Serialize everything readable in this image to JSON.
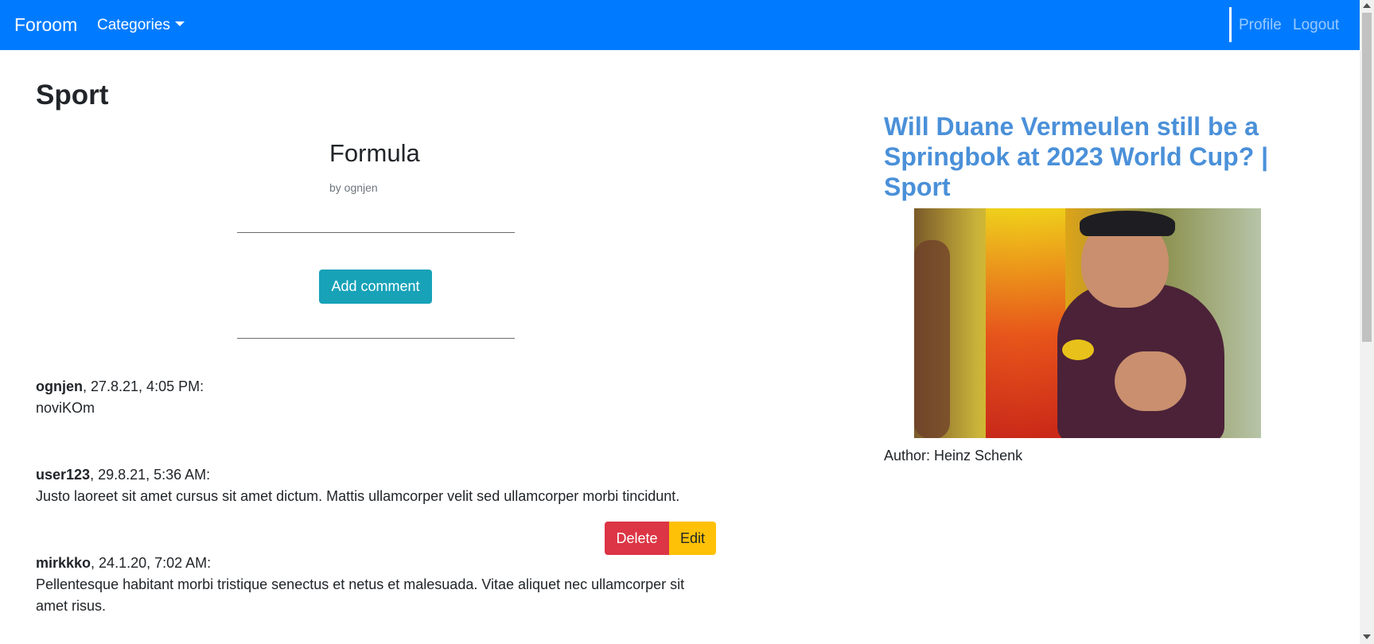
{
  "navbar": {
    "brand": "Foroom",
    "categories_label": "Categories",
    "profile_label": "Profile",
    "logout_label": "Logout",
    "color": "#007bff"
  },
  "page": {
    "title": "Sport"
  },
  "post": {
    "title": "Formula",
    "author": "by ognjen",
    "add_comment_label": "Add comment"
  },
  "comments": [
    {
      "user": "ognjen",
      "meta": ", 27.8.21, 4:05 PM:",
      "text": "noviKOm"
    },
    {
      "user": "user123",
      "meta": ", 29.8.21, 5:36 AM:",
      "text": "Justo laoreet sit amet cursus sit amet dictum. Mattis ullamcorper velit sed ullamcorper morbi tincidunt."
    },
    {
      "user": "mirkkko",
      "meta": ", 24.1.20, 7:02 AM:",
      "text": "Pellentesque habitant morbi tristique senectus et netus et malesuada. Vitae aliquet nec ullamcorper sit amet risus."
    }
  ],
  "comment_actions": {
    "delete_label": "Delete",
    "edit_label": "Edit",
    "delete_color": "#dc3545",
    "edit_color": "#ffc107"
  },
  "news": {
    "title": "Will Duane Vermeulen still be a Springbok at 2023 World Cup? | Sport",
    "author": "Author: Heinz Schenk",
    "image_icon": "rugby-player-photo"
  }
}
